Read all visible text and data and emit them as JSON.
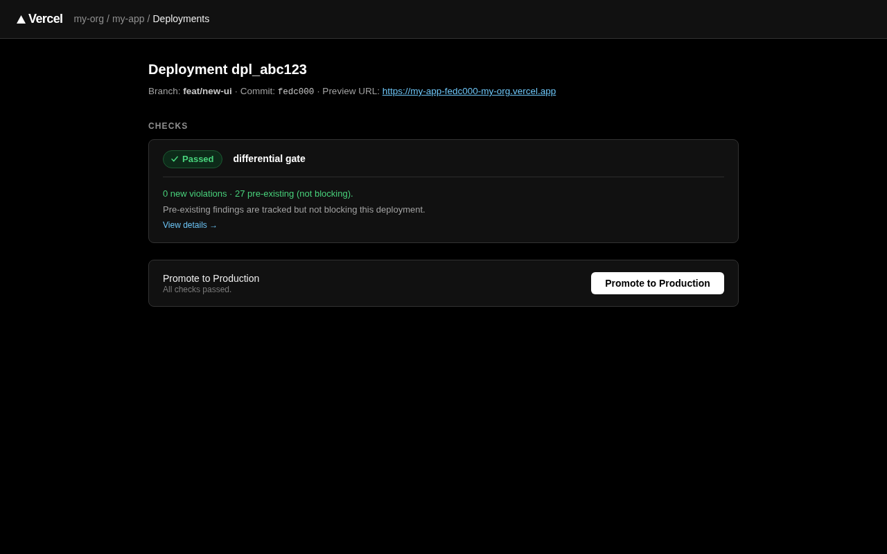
{
  "header": {
    "logo": "Vercel",
    "breadcrumb": [
      {
        "label": "my-org",
        "current": false
      },
      {
        "label": "my-app",
        "current": false
      },
      {
        "label": "Deployments",
        "current": true
      }
    ],
    "separators": [
      "/",
      "/"
    ]
  },
  "deployment": {
    "title": "Deployment dpl_abc123",
    "meta": [
      {
        "kind": "text",
        "text": "Branch:"
      },
      {
        "kind": "bold",
        "text": "feat/new-ui"
      },
      {
        "kind": "text",
        "text": "· Commit:"
      },
      {
        "kind": "code",
        "text": "fedc000"
      },
      {
        "kind": "text",
        "text": "· Preview URL:"
      },
      {
        "kind": "link",
        "text": "https://my-app-fedc000-my-org.vercel.app"
      }
    ]
  },
  "checks": {
    "heading": "CHECKS",
    "items": [
      {
        "passed": true,
        "status_label": "Passed",
        "name": "differential gate",
        "summary": "0 new violations · 27 pre-existing (not blocking).",
        "note": "Pre-existing findings are tracked but not blocking this deployment.",
        "link": "View details →"
      }
    ]
  },
  "promote": {
    "title": "Promote to Production",
    "subtitle": "All checks passed.",
    "button": "Promote to Production"
  }
}
